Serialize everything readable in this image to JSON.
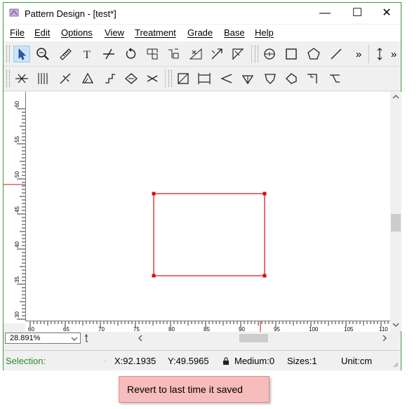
{
  "window": {
    "title": "Pattern Design - [test*]",
    "minimize_glyph": "—",
    "maximize_glyph": "☐",
    "close_glyph": "✕"
  },
  "menu": {
    "items": [
      "File",
      "Edit",
      "Options",
      "View",
      "Treatment",
      "Grade",
      "Base",
      "Help"
    ]
  },
  "toolbar1": {
    "overflow_glyph": "»",
    "overflow2_glyph": "»",
    "tools": [
      "select-arrow-icon",
      "zoom-icon",
      "ruler-icon",
      "text-icon",
      "cut-line-icon",
      "rotate-icon",
      "mirror-icon",
      "flip-icon",
      "measure-angle-icon",
      "resize-icon",
      "scale-icon",
      "circle-target-icon",
      "rectangle-icon",
      "polygon-icon",
      "line-icon",
      "move-vertical-icon"
    ]
  },
  "toolbar2": {
    "tools": [
      "dart-icon",
      "pleat-icon",
      "notch-icon",
      "triangle-icon",
      "fold-icon",
      "seam-icon",
      "shift-icon",
      "grade-box-icon",
      "width-icon",
      "arrow-icon",
      "drop-icon",
      "collar-icon",
      "sleeve-icon",
      "corner-icon",
      "hem-icon"
    ]
  },
  "vruler": {
    "labels": [
      "60",
      "55",
      "50",
      "45",
      "40",
      "35",
      "30"
    ]
  },
  "hruler": {
    "labels": [
      "60",
      "65",
      "70",
      "75",
      "80",
      "85",
      "90",
      "95",
      "100",
      "105",
      "110"
    ]
  },
  "zoom": {
    "value": "28.891%"
  },
  "status": {
    "selection_label": "Selection:",
    "x": "X:92.1935",
    "y": "Y:49.5965",
    "medium": "Medium:0",
    "sizes": "Sizes:1",
    "unit": "Unit:cm"
  },
  "colors": {
    "shape": "#d01010",
    "status_green": "#2a8a2a",
    "revert_bg": "#f7bcbc"
  },
  "revert_button": {
    "label": "Revert to last time it saved"
  }
}
